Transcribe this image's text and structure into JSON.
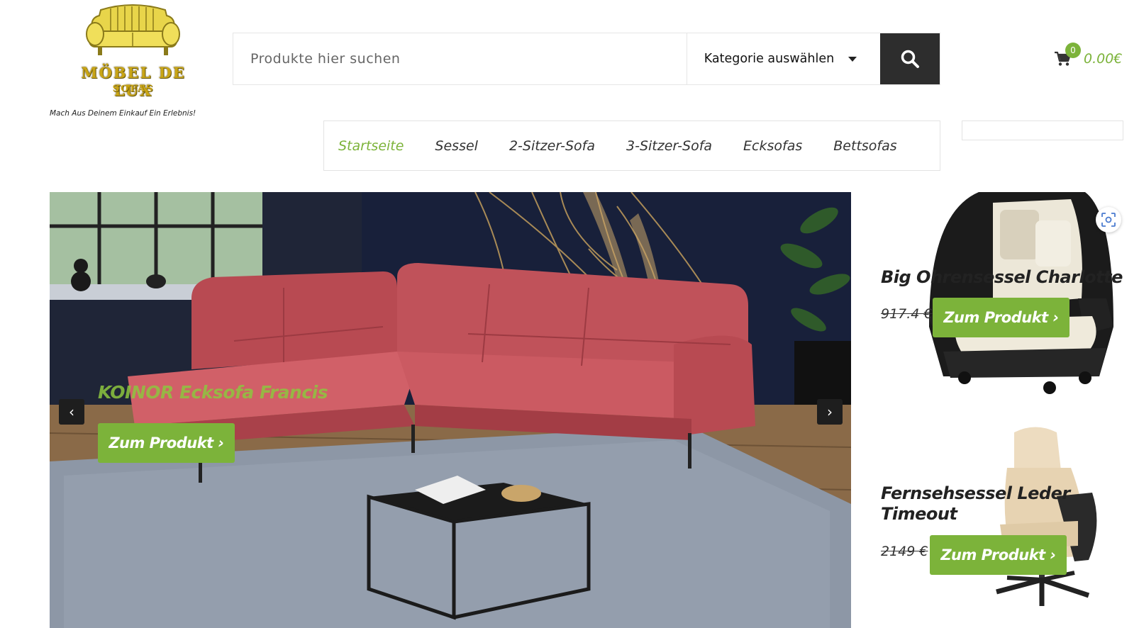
{
  "brand": {
    "name": "MÖBEL DE LUX",
    "sub": "SOFAS",
    "tagline": "Mach Aus Deinem Einkauf Ein Erlebnis!"
  },
  "search": {
    "placeholder": "Produkte hier suchen",
    "category_label": "Kategorie auswählen"
  },
  "cart": {
    "count": "0",
    "total": "0.00€"
  },
  "nav": {
    "items": [
      {
        "label": "Startseite",
        "active": true
      },
      {
        "label": "Sessel"
      },
      {
        "label": "2-Sitzer-Sofa"
      },
      {
        "label": "3-Sitzer-Sofa"
      },
      {
        "label": "Ecksofas"
      },
      {
        "label": "Bettsofas"
      }
    ]
  },
  "hero": {
    "title": "KOINOR Ecksofa Francis",
    "button": "Zum Produkt ›",
    "prev_icon": "chevron-left-icon",
    "next_icon": "chevron-right-icon"
  },
  "products": [
    {
      "title": "Big Ohrensessel Charlotte",
      "old_price": "917.4 €",
      "button": "Zum Produkt ›"
    },
    {
      "title": "Fernsehsessel Leder Timeout",
      "old_price": "2149 €",
      "button": "Zum Produkt ›"
    }
  ],
  "colors": {
    "accent": "#7cb33a",
    "dark": "#2d2d2d",
    "sofa": "#c9535a",
    "logo_gold": "#c9a515"
  }
}
